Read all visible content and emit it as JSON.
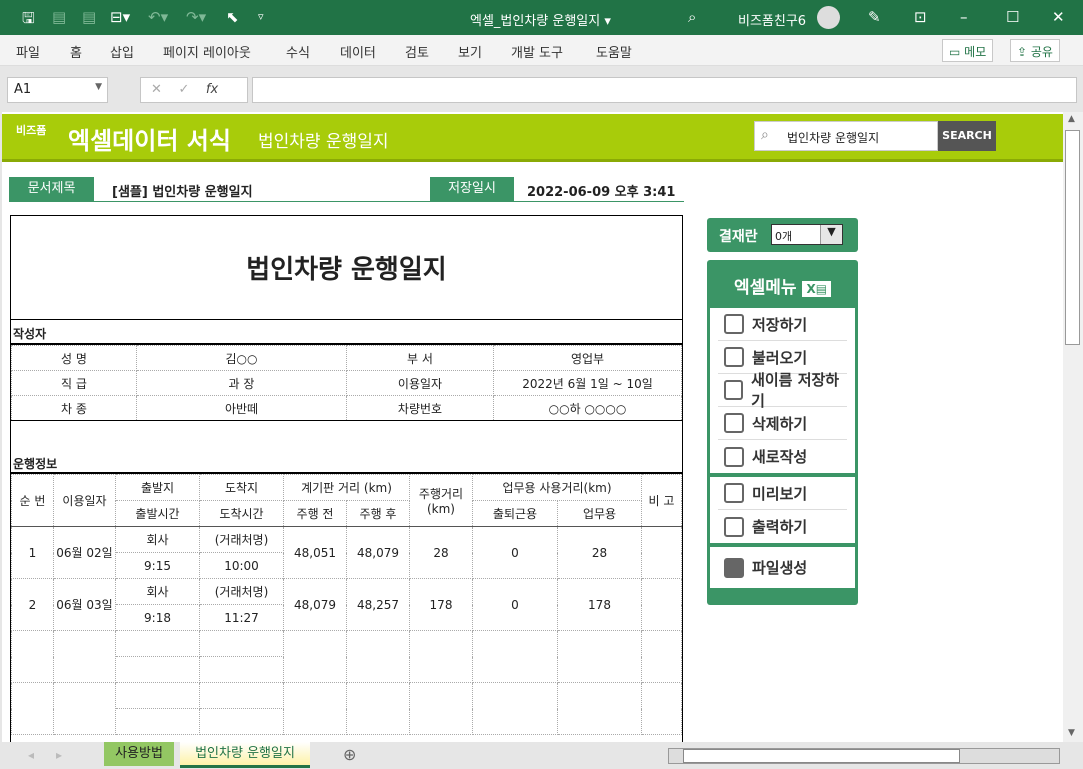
{
  "window": {
    "title": "엑셀_법인차량 운행일지",
    "title_caret": "▾",
    "user": "비즈폼친구6"
  },
  "ribbon_tabs": [
    "파일",
    "홈",
    "삽입",
    "페이지 레이아웃",
    "수식",
    "데이터",
    "검토",
    "보기",
    "개발 도구",
    "도움말"
  ],
  "ribbon_buttons": {
    "memo": "메모",
    "share": "공유"
  },
  "formula_bar": {
    "name_box": "A1",
    "fx": "fx",
    "value": ""
  },
  "banner": {
    "brand_small": "비즈폼",
    "brand": "엑셀데이터 서식",
    "subtitle": "법인차량 운행일지",
    "search_value": "법인차량 운행일지",
    "search_button": "SEARCH"
  },
  "doc": {
    "title_label": "문서제목",
    "title_value": "[샘플] 법인차량 운행일지",
    "saved_label": "저장일시",
    "saved_value": "2022-06-09  오후 3:41"
  },
  "form": {
    "heading": "법인차량 운행일지",
    "author_section": "작성자",
    "trip_section": "운행정보",
    "info": [
      [
        "성   명",
        "김○○",
        "부      서",
        "영업부"
      ],
      [
        "직   급",
        "과   장",
        "이용일자",
        "2022년 6월 1일 ~ 10일"
      ],
      [
        "차   종",
        "아반떼",
        "차량번호",
        "○○하 ○○○○"
      ]
    ],
    "headers": {
      "no": "순 번",
      "date": "이용일자",
      "dep": "출발지",
      "arr": "도착지",
      "meter": "계기판 거리 (km)",
      "dist": "주행거리 (km)",
      "biz": "업무용 사용거리(km)",
      "note": "비 고",
      "dep_time": "출발시간",
      "arr_time": "도착시간",
      "before": "주행 전",
      "after": "주행 후",
      "commute": "출퇴근용",
      "business": "업무용"
    },
    "rows": [
      {
        "no": "1",
        "date": "06월 02일",
        "dep": "회사",
        "arr": "(거래처명)",
        "dep_time": "9:15",
        "arr_time": "10:00",
        "before": "48,051",
        "after": "48,079",
        "dist": "28",
        "commute": "0",
        "business": "28"
      },
      {
        "no": "2",
        "date": "06월 03일",
        "dep": "회사",
        "arr": "(거래처명)",
        "dep_time": "9:18",
        "arr_time": "11:27",
        "before": "48,079",
        "after": "48,257",
        "dist": "178",
        "commute": "0",
        "business": "178"
      }
    ]
  },
  "approval": {
    "label": "결재란",
    "value": "0개"
  },
  "excel_menu": {
    "title": "엑셀메뉴",
    "groups": [
      [
        "저장하기",
        "불러오기",
        "새이름 저장하기",
        "삭제하기",
        "새로작성"
      ],
      [
        "미리보기",
        "출력하기"
      ],
      [
        "파일생성"
      ]
    ]
  },
  "sheet_tabs": [
    "사용방법",
    "법인차량 운행일지"
  ],
  "colors": {
    "excel_green": "#217346",
    "banner": "#a8cc0a",
    "label_green": "#3b9566"
  }
}
